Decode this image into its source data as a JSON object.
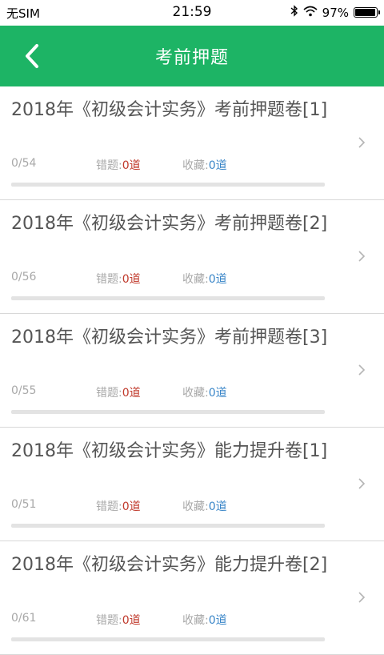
{
  "status_bar": {
    "carrier": "无SIM",
    "time": "21:59",
    "battery_text": "97%",
    "battery_level": 0.97,
    "icons": [
      "bluetooth-icon",
      "wifi-icon",
      "battery-icon"
    ]
  },
  "header": {
    "back_icon": "chevron-left-icon",
    "title": "考前押题",
    "color": "#1db465"
  },
  "items": [
    {
      "title": "2018年《初级会计实务》考前押题卷[1]",
      "progress_text": "0/54",
      "progress": 0,
      "wrong_label": "错题:",
      "wrong_value": "0道",
      "fav_label": "收藏:",
      "fav_value": "0道"
    },
    {
      "title": "2018年《初级会计实务》考前押题卷[2]",
      "progress_text": "0/56",
      "progress": 0,
      "wrong_label": "错题:",
      "wrong_value": "0道",
      "fav_label": "收藏:",
      "fav_value": "0道"
    },
    {
      "title": "2018年《初级会计实务》考前押题卷[3]",
      "progress_text": "0/55",
      "progress": 0,
      "wrong_label": "错题:",
      "wrong_value": "0道",
      "fav_label": "收藏:",
      "fav_value": "0道"
    },
    {
      "title": "2018年《初级会计实务》能力提升卷[1]",
      "progress_text": "0/51",
      "progress": 0,
      "wrong_label": "错题:",
      "wrong_value": "0道",
      "fav_label": "收藏:",
      "fav_value": "0道"
    },
    {
      "title": "2018年《初级会计实务》能力提升卷[2]",
      "progress_text": "0/61",
      "progress": 0,
      "wrong_label": "错题:",
      "wrong_value": "0道",
      "fav_label": "收藏:",
      "fav_value": "0道"
    }
  ]
}
